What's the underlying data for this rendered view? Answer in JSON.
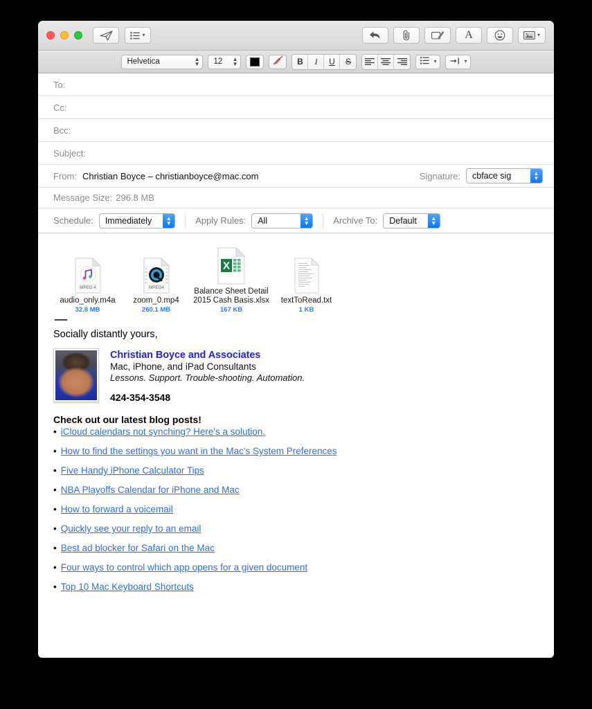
{
  "window": {
    "traffic_lights": [
      "close",
      "minimize",
      "zoom"
    ]
  },
  "toolbar": {
    "send_label": "send-icon",
    "header_fields_label": "header-fields-icon",
    "reply_label": "reply-icon",
    "attach_label": "attach-icon",
    "markup_label": "markup-icon",
    "format_label": "A",
    "emoji_label": "emoji-icon",
    "photo_label": "photo-browser-icon"
  },
  "formatbar": {
    "font_family": "Helvetica",
    "font_size": "12",
    "color_swatch": "#000000",
    "bold": "B",
    "italic": "I",
    "underline": "U",
    "strikethrough": "S",
    "align_left": "align-left-icon",
    "align_center": "align-center-icon",
    "align_right": "align-right-icon",
    "list_icon": "list-icon",
    "indent_icon": "indent-icon"
  },
  "headers": {
    "to": {
      "label": "To:",
      "value": ""
    },
    "cc": {
      "label": "Cc:",
      "value": ""
    },
    "bcc": {
      "label": "Bcc:",
      "value": ""
    },
    "subject": {
      "label": "Subject:",
      "value": ""
    },
    "from": {
      "label": "From:",
      "value": "Christian Boyce – christianboyce@mac.com"
    },
    "signature": {
      "label": "Signature:",
      "value": "cbface sig"
    },
    "message_size": {
      "label": "Message Size:",
      "value": "296.8 MB"
    }
  },
  "schedule_row": {
    "schedule": {
      "label": "Schedule:",
      "value": "Immediately"
    },
    "apply_rules": {
      "label": "Apply Rules:",
      "value": "All"
    },
    "archive_to": {
      "label": "Archive To:",
      "value": "Default"
    }
  },
  "attachments": [
    {
      "name": "audio_only.m4a",
      "size": "32.8 MB",
      "kind": "mpeg4-audio",
      "badge": "MPEG 4"
    },
    {
      "name": "zoom_0.mp4",
      "size": "260.1 MB",
      "kind": "mpeg4-video",
      "badge": "MPEG4"
    },
    {
      "name": "Balance Sheet Detail 2015 Cash Basis.xlsx",
      "size": "167 KB",
      "kind": "excel",
      "badge": "X"
    },
    {
      "name": "textToRead.txt",
      "size": "1 KB",
      "kind": "text",
      "badge": ""
    }
  ],
  "body": {
    "closing": "Socially distantly yours,",
    "signature": {
      "company": "Christian Boyce and Associates",
      "role": "Mac, iPhone, and iPad Consultants",
      "tagline": "Lessons. Support. Trouble-shooting. Automation.",
      "phone": "424-354-3548"
    },
    "blog": {
      "heading": "Check out our latest blog posts!",
      "bullet": "•",
      "links": [
        "iCloud calendars not synching? Here's a solution.",
        "How to find the settings you want in the Mac's System Preferences",
        "Five Handy iPhone Calculator Tips",
        "NBA Playoffs Calendar for iPhone and Mac",
        "How to forward a voicemail",
        "Quickly see your reply to an email",
        "Best ad blocker for Safari on the Mac",
        "Four ways to control which app opens for a given document",
        "Top 10 Mac Keyboard Shortcuts"
      ]
    }
  },
  "colors": {
    "link": "#2b6ee8",
    "company": "#2323d8",
    "filesize": "#2b7bf0",
    "accent_blue": "#0a78f0"
  }
}
